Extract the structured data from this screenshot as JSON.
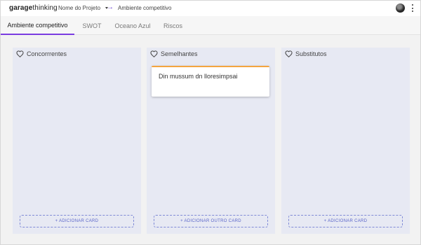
{
  "header": {
    "logo_bold": "garage",
    "logo_light": "thinking",
    "project": "Nome do Projeto",
    "breadcrumb": "Ambiente competitivo"
  },
  "tabs": [
    {
      "label": "Ambiente competitivo",
      "active": true
    },
    {
      "label": "SWOT",
      "active": false
    },
    {
      "label": "Oceano Azul",
      "active": false
    },
    {
      "label": "Riscos",
      "active": false
    }
  ],
  "columns": [
    {
      "title": "Concorrrentes",
      "cards": [],
      "add_label": "+ ADICIONAR CARD"
    },
    {
      "title": "Semelhantes",
      "cards": [
        {
          "text": "Din mussum dn lloresimpsai"
        }
      ],
      "add_label": "+ ADICIONAR OUTRO CARD"
    },
    {
      "title": "Substitutos",
      "cards": [],
      "add_label": "+ ADICIONAR CARD"
    }
  ],
  "colors": {
    "accent": "#7a3ce0",
    "card_border": "#f4a540",
    "column_bg": "#e7e9f3",
    "add_button": "#5b66c9"
  },
  "icons": {
    "column_icon": "heart-outline-icon",
    "breadcrumb_separator": "arrow-right-icon",
    "project_dropdown": "caret-down-icon",
    "menu": "more-vertical-icon"
  }
}
